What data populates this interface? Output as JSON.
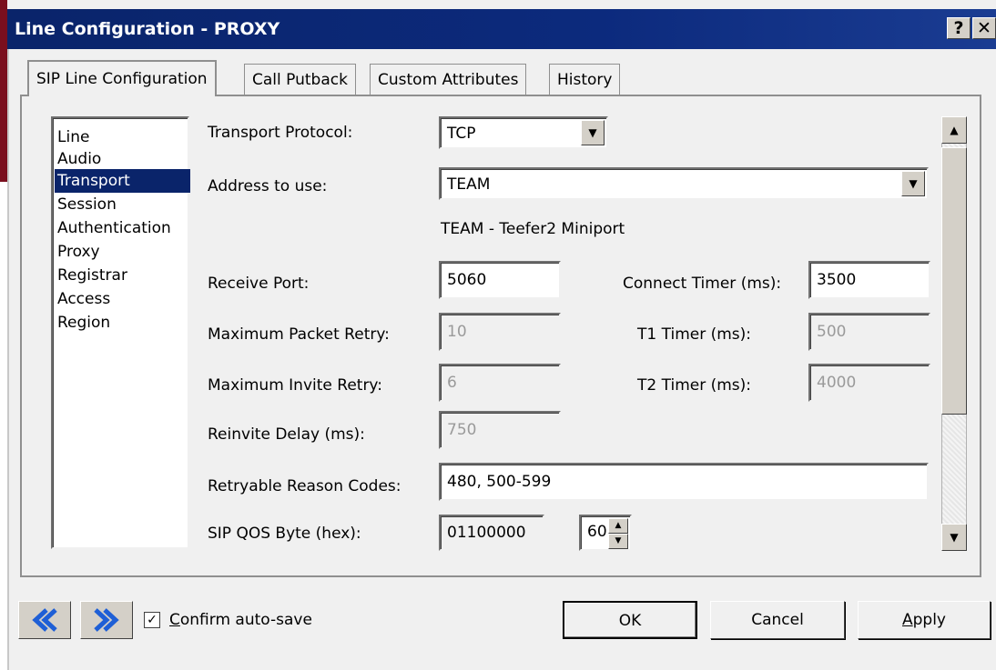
{
  "window": {
    "title": "Line Configuration - PROXY",
    "help_glyph": "?",
    "close_glyph": "✕"
  },
  "tabs": [
    {
      "label": "SIP Line Configuration",
      "active": true
    },
    {
      "label": "Call Putback",
      "active": false
    },
    {
      "label": "Custom Attributes",
      "active": false
    },
    {
      "label": "History",
      "active": false
    }
  ],
  "sidebar": {
    "items": [
      "Line",
      "Audio",
      "Transport",
      "Session",
      "Authentication",
      "Proxy",
      "Registrar",
      "Access",
      "Region"
    ],
    "selected": "Transport"
  },
  "form": {
    "transport_protocol": {
      "label": "Transport Protocol:",
      "value": "TCP"
    },
    "address_to_use": {
      "label": "Address to use:",
      "value": "TEAM",
      "description": "TEAM - Teefer2 Miniport"
    },
    "receive_port": {
      "label": "Receive Port:",
      "value": "5060"
    },
    "connect_timer": {
      "label": "Connect Timer (ms):",
      "value": "3500"
    },
    "max_packet_retry": {
      "label": "Maximum Packet Retry:",
      "value": "10"
    },
    "t1_timer": {
      "label": "T1 Timer (ms):",
      "value": "500"
    },
    "max_invite_retry": {
      "label": "Maximum Invite Retry:",
      "value": "6"
    },
    "t2_timer": {
      "label": "T2 Timer (ms):",
      "value": "4000"
    },
    "reinvite_delay": {
      "label": "Reinvite Delay (ms):",
      "value": "750"
    },
    "retryable_reason_codes": {
      "label": "Retryable Reason Codes:",
      "value": "480, 500-599"
    },
    "sip_qos_byte": {
      "label": "SIP QOS Byte (hex):",
      "binary": "01100000",
      "hex": "60"
    }
  },
  "footer": {
    "confirm_autosave": {
      "mnemonic": "C",
      "rest": "onfirm auto-save",
      "checked": true
    },
    "ok_label": "OK",
    "cancel_label": "Cancel",
    "apply": {
      "mnemonic": "A",
      "rest": "pply"
    }
  },
  "colors": {
    "titlebar": "#0a246a",
    "selection": "#0a246a",
    "nav_arrow": "#1e5fd6"
  }
}
